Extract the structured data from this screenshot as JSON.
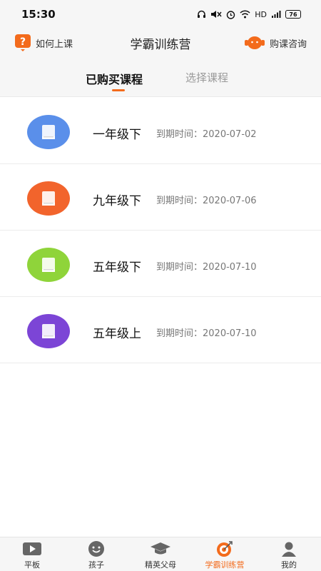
{
  "status_bar": {
    "time": "15:30",
    "network": "HD",
    "battery": "76"
  },
  "header": {
    "left_label": "如何上课",
    "title": "学霸训练营",
    "right_label": "购课咨询",
    "accent_color": "#f36b1c"
  },
  "tabs": [
    {
      "label": "已购买课程",
      "active": true
    },
    {
      "label": "选择课程",
      "active": false
    }
  ],
  "courses": [
    {
      "name": "一年级下",
      "expire": "到期时间：2020-07-02",
      "color": "#5a8fea",
      "icon": "book-icon"
    },
    {
      "name": "九年级下",
      "expire": "到期时间：2020-07-06",
      "color": "#f2642c",
      "icon": "book-icon"
    },
    {
      "name": "五年级下",
      "expire": "到期时间：2020-07-10",
      "color": "#8fd43a",
      "icon": "book-icon"
    },
    {
      "name": "五年级上",
      "expire": "到期时间：2020-07-10",
      "color": "#7c45d6",
      "icon": "book-icon"
    }
  ],
  "bottom_nav": [
    {
      "label": "平板",
      "icon": "play-icon",
      "active": false
    },
    {
      "label": "孩子",
      "icon": "smile-icon",
      "active": false
    },
    {
      "label": "精英父母",
      "icon": "graduation-cap-icon",
      "active": false
    },
    {
      "label": "学霸训练营",
      "icon": "target-icon",
      "active": true
    },
    {
      "label": "我的",
      "icon": "user-icon",
      "active": false
    }
  ]
}
